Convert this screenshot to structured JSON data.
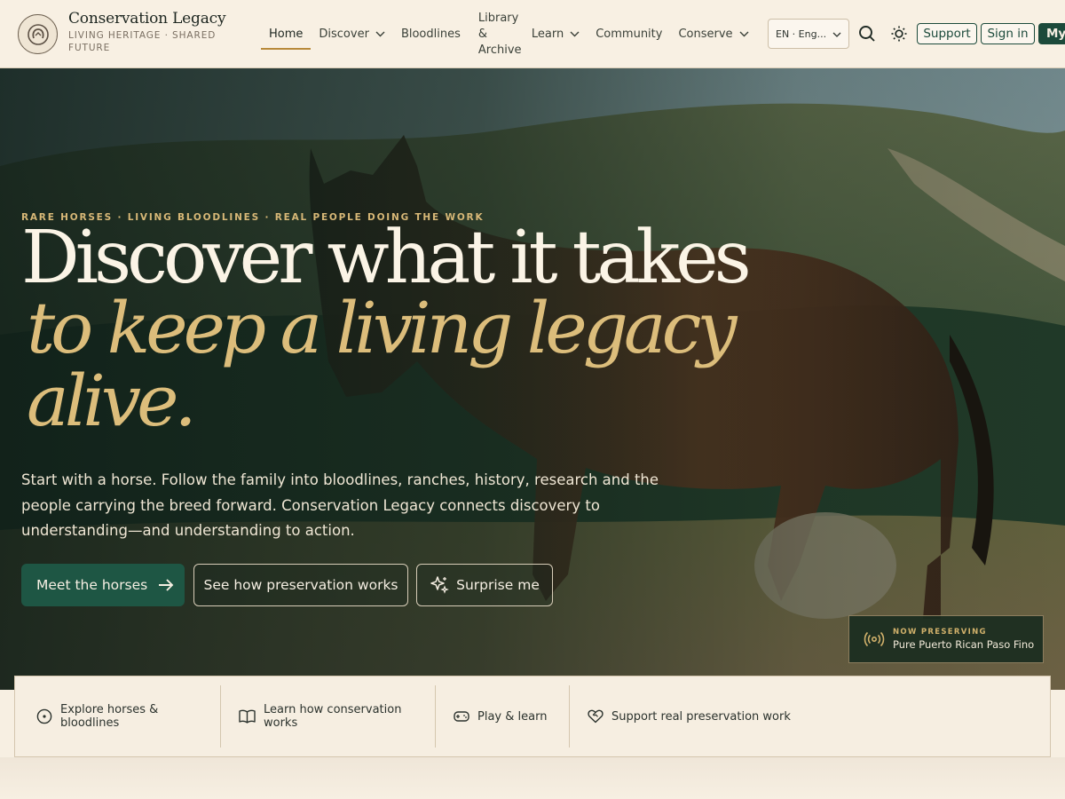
{
  "brand": {
    "title": "Conservation Legacy",
    "subtitle": "LIVING HERITAGE · SHARED FUTURE",
    "logo_icon": "horseshoe-seal-icon"
  },
  "nav": {
    "items": [
      {
        "label": "Home",
        "active": true,
        "dropdown": false
      },
      {
        "label": "Discover",
        "active": false,
        "dropdown": true
      },
      {
        "label": "Bloodlines",
        "active": false,
        "dropdown": false
      },
      {
        "label": "Library & Archive",
        "active": false,
        "dropdown": false
      },
      {
        "label": "Learn",
        "active": false,
        "dropdown": true
      },
      {
        "label": "Community",
        "active": false,
        "dropdown": false
      },
      {
        "label": "Conserve",
        "active": false,
        "dropdown": true
      }
    ]
  },
  "header": {
    "language_value": "EN · Eng...",
    "support_label": "Support",
    "signin_label": "Sign in",
    "my_label": "My",
    "search_icon": "search-icon",
    "theme_icon": "sun-icon"
  },
  "hero": {
    "eyebrow": "RARE HORSES · LIVING BLOODLINES · REAL PEOPLE DOING THE WORK",
    "headline_line1": "Discover what it takes",
    "headline_line2": "to keep a living legacy",
    "headline_line3": "alive.",
    "lede": "Start with a horse. Follow the family into bloodlines, ranches, history, research and the people carrying the breed forward. Conservation Legacy connects discovery to understanding—and understanding to action.",
    "cta_primary": "Meet the horses",
    "cta_secondary": "See how preservation works",
    "cta_tertiary": "Surprise me"
  },
  "now_preserving": {
    "label": "NOW PRESERVING",
    "value": "Pure Puerto Rican Paso Fino",
    "icon": "broadcast-icon"
  },
  "quick_links": [
    {
      "label": "Explore horses & bloodlines",
      "icon": "compass-icon"
    },
    {
      "label": "Learn how conservation works",
      "icon": "book-icon"
    },
    {
      "label": "Play & learn",
      "icon": "gamepad-icon"
    },
    {
      "label": "Support real preservation work",
      "icon": "heart-handshake-icon"
    }
  ],
  "colors": {
    "accent_green": "#1e5644",
    "accent_gold": "#dcbd7b",
    "background": "#f7efe2"
  }
}
